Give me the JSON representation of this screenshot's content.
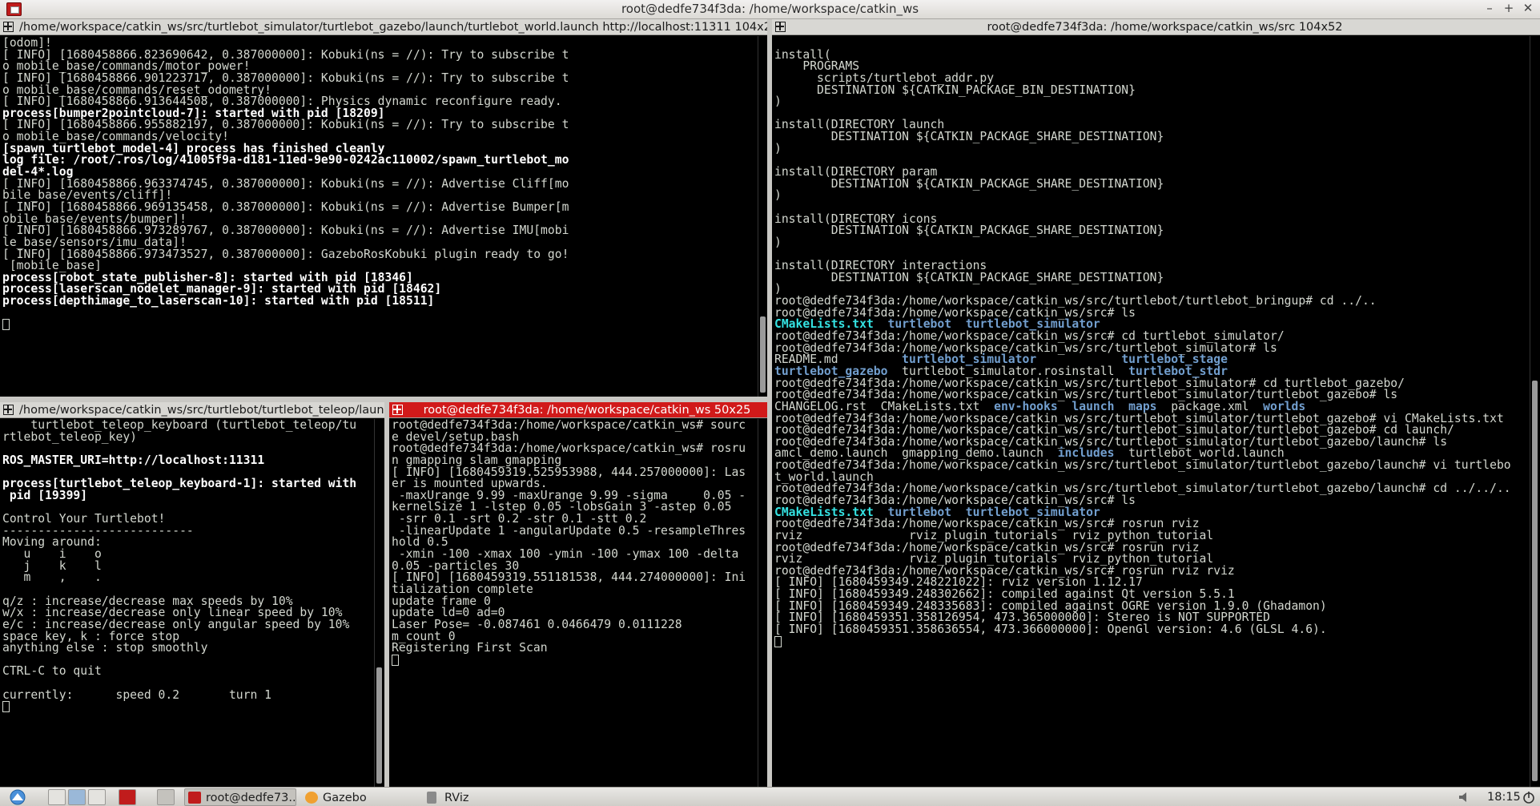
{
  "window": {
    "title": "root@dedfe734f3da: /home/workspace/catkin_ws",
    "minimize_glyph": "–",
    "maximize_glyph": "+",
    "close_glyph": "✕"
  },
  "panes": {
    "top_left": {
      "title": "/home/workspace/catkin_ws/src/turtlebot_simulator/turtlebot_gazebo/launch/turtlebot_world.launch http://localhost:11311 104x25",
      "lines": [
        {
          "t": "[odom]!",
          "s": ""
        },
        {
          "t": "[ INFO] [1680458866.823690642, 0.387000000]: Kobuki(ns = //): Try to subscribe t",
          "s": ""
        },
        {
          "t": "o mobile_base/commands/motor_power!",
          "s": ""
        },
        {
          "t": "[ INFO] [1680458866.901223717, 0.387000000]: Kobuki(ns = //): Try to subscribe t",
          "s": ""
        },
        {
          "t": "o mobile_base/commands/reset_odometry!",
          "s": ""
        },
        {
          "t": "[ INFO] [1680458866.913644508, 0.387000000]: Physics dynamic reconfigure ready.",
          "s": ""
        },
        {
          "t": "process[bumper2pointcloud-7]: started with pid [18209]",
          "s": "b"
        },
        {
          "t": "[ INFO] [1680458866.955882197, 0.387000000]: Kobuki(ns = //): Try to subscribe t",
          "s": ""
        },
        {
          "t": "o mobile_base/commands/velocity!",
          "s": ""
        },
        {
          "t": "[spawn_turtlebot_model-4] process has finished cleanly",
          "s": "b"
        },
        {
          "t": "log file: /root/.ros/log/41005f9a-d181-11ed-9e90-0242ac110002/spawn_turtlebot_mo",
          "s": "b"
        },
        {
          "t": "del-4*.log",
          "s": "b"
        },
        {
          "t": "[ INFO] [1680458866.963374745, 0.387000000]: Kobuki(ns = //): Advertise Cliff[mo",
          "s": ""
        },
        {
          "t": "bile_base/events/cliff]!",
          "s": ""
        },
        {
          "t": "[ INFO] [1680458866.969135458, 0.387000000]: Kobuki(ns = //): Advertise Bumper[m",
          "s": ""
        },
        {
          "t": "obile_base/events/bumper]!",
          "s": ""
        },
        {
          "t": "[ INFO] [1680458866.973289767, 0.387000000]: Kobuki(ns = //): Advertise IMU[mobi",
          "s": ""
        },
        {
          "t": "le_base/sensors/imu_data]!",
          "s": ""
        },
        {
          "t": "[ INFO] [1680458866.973473527, 0.387000000]: GazeboRosKobuki plugin ready to go!",
          "s": ""
        },
        {
          "t": " [mobile_base]",
          "s": ""
        },
        {
          "t": "process[robot_state_publisher-8]: started with pid [18346]",
          "s": "b"
        },
        {
          "t": "process[laserscan_nodelet_manager-9]: started with pid [18462]",
          "s": "b"
        },
        {
          "t": "process[depthimage_to_laserscan-10]: started with pid [18511]",
          "s": "b"
        },
        {
          "t": "",
          "s": ""
        },
        {
          "t": "",
          "s": "cursor"
        }
      ]
    },
    "right": {
      "title": "root@dedfe734f3da: /home/workspace/catkin_ws/src 104x52",
      "lines": [
        {
          "segs": [
            {
              "t": "",
              "s": ""
            }
          ]
        },
        {
          "segs": [
            {
              "t": "install(",
              "s": ""
            }
          ]
        },
        {
          "segs": [
            {
              "t": "    PROGRAMS",
              "s": ""
            }
          ]
        },
        {
          "segs": [
            {
              "t": "      scripts/turtlebot_addr.py",
              "s": ""
            }
          ]
        },
        {
          "segs": [
            {
              "t": "      DESTINATION ${CATKIN_PACKAGE_BIN_DESTINATION}",
              "s": ""
            }
          ]
        },
        {
          "segs": [
            {
              "t": ")",
              "s": ""
            }
          ]
        },
        {
          "segs": [
            {
              "t": "",
              "s": ""
            }
          ]
        },
        {
          "segs": [
            {
              "t": "install(DIRECTORY launch",
              "s": ""
            }
          ]
        },
        {
          "segs": [
            {
              "t": "        DESTINATION ${CATKIN_PACKAGE_SHARE_DESTINATION}",
              "s": ""
            }
          ]
        },
        {
          "segs": [
            {
              "t": ")",
              "s": ""
            }
          ]
        },
        {
          "segs": [
            {
              "t": "",
              "s": ""
            }
          ]
        },
        {
          "segs": [
            {
              "t": "install(DIRECTORY param",
              "s": ""
            }
          ]
        },
        {
          "segs": [
            {
              "t": "        DESTINATION ${CATKIN_PACKAGE_SHARE_DESTINATION}",
              "s": ""
            }
          ]
        },
        {
          "segs": [
            {
              "t": ")",
              "s": ""
            }
          ]
        },
        {
          "segs": [
            {
              "t": "",
              "s": ""
            }
          ]
        },
        {
          "segs": [
            {
              "t": "install(DIRECTORY icons",
              "s": ""
            }
          ]
        },
        {
          "segs": [
            {
              "t": "        DESTINATION ${CATKIN_PACKAGE_SHARE_DESTINATION}",
              "s": ""
            }
          ]
        },
        {
          "segs": [
            {
              "t": ")",
              "s": ""
            }
          ]
        },
        {
          "segs": [
            {
              "t": "",
              "s": ""
            }
          ]
        },
        {
          "segs": [
            {
              "t": "install(DIRECTORY interactions",
              "s": ""
            }
          ]
        },
        {
          "segs": [
            {
              "t": "        DESTINATION ${CATKIN_PACKAGE_SHARE_DESTINATION}",
              "s": ""
            }
          ]
        },
        {
          "segs": [
            {
              "t": ")",
              "s": ""
            }
          ]
        },
        {
          "segs": [
            {
              "t": "root@dedfe734f3da:/home/workspace/catkin_ws/src/turtlebot/turtlebot_bringup# cd ../..",
              "s": ""
            }
          ]
        },
        {
          "segs": [
            {
              "t": "root@dedfe734f3da:/home/workspace/catkin_ws/src# ls",
              "s": ""
            }
          ]
        },
        {
          "segs": [
            {
              "t": "CMakeLists.txt",
              "s": "cyan"
            },
            {
              "t": "  ",
              "s": ""
            },
            {
              "t": "turtlebot",
              "s": "dir"
            },
            {
              "t": "  ",
              "s": ""
            },
            {
              "t": "turtlebot_simulator",
              "s": "dir"
            }
          ]
        },
        {
          "segs": [
            {
              "t": "root@dedfe734f3da:/home/workspace/catkin_ws/src# cd turtlebot_simulator/",
              "s": ""
            }
          ]
        },
        {
          "segs": [
            {
              "t": "root@dedfe734f3da:/home/workspace/catkin_ws/src/turtlebot_simulator# ls",
              "s": ""
            }
          ]
        },
        {
          "segs": [
            {
              "t": "README.md         ",
              "s": ""
            },
            {
              "t": "turtlebot_simulator",
              "s": "dir"
            },
            {
              "t": "            ",
              "s": ""
            },
            {
              "t": "turtlebot_stage",
              "s": "dir"
            }
          ]
        },
        {
          "segs": [
            {
              "t": "turtlebot_gazebo",
              "s": "dir"
            },
            {
              "t": "  turtlebot_simulator.rosinstall  ",
              "s": ""
            },
            {
              "t": "turtlebot_stdr",
              "s": "dir"
            }
          ]
        },
        {
          "segs": [
            {
              "t": "root@dedfe734f3da:/home/workspace/catkin_ws/src/turtlebot_simulator# cd turtlebot_gazebo/",
              "s": ""
            }
          ]
        },
        {
          "segs": [
            {
              "t": "root@dedfe734f3da:/home/workspace/catkin_ws/src/turtlebot_simulator/turtlebot_gazebo# ls",
              "s": ""
            }
          ]
        },
        {
          "segs": [
            {
              "t": "CHANGELOG.rst  CMakeLists.txt  ",
              "s": ""
            },
            {
              "t": "env-hooks",
              "s": "dir"
            },
            {
              "t": "  ",
              "s": ""
            },
            {
              "t": "launch",
              "s": "dir"
            },
            {
              "t": "  ",
              "s": ""
            },
            {
              "t": "maps",
              "s": "dir"
            },
            {
              "t": "  package.xml  ",
              "s": ""
            },
            {
              "t": "worlds",
              "s": "dir"
            }
          ]
        },
        {
          "segs": [
            {
              "t": "root@dedfe734f3da:/home/workspace/catkin_ws/src/turtlebot_simulator/turtlebot_gazebo# vi CMakeLists.txt",
              "s": ""
            }
          ]
        },
        {
          "segs": [
            {
              "t": "root@dedfe734f3da:/home/workspace/catkin_ws/src/turtlebot_simulator/turtlebot_gazebo# cd launch/",
              "s": ""
            }
          ]
        },
        {
          "segs": [
            {
              "t": "root@dedfe734f3da:/home/workspace/catkin_ws/src/turtlebot_simulator/turtlebot_gazebo/launch# ls",
              "s": ""
            }
          ]
        },
        {
          "segs": [
            {
              "t": "amcl_demo.launch  gmapping_demo.launch  ",
              "s": ""
            },
            {
              "t": "includes",
              "s": "dir"
            },
            {
              "t": "  turtlebot_world.launch",
              "s": ""
            }
          ]
        },
        {
          "segs": [
            {
              "t": "root@dedfe734f3da:/home/workspace/catkin_ws/src/turtlebot_simulator/turtlebot_gazebo/launch# vi turtlebo",
              "s": ""
            }
          ]
        },
        {
          "segs": [
            {
              "t": "t_world.launch",
              "s": ""
            }
          ]
        },
        {
          "segs": [
            {
              "t": "root@dedfe734f3da:/home/workspace/catkin_ws/src/turtlebot_simulator/turtlebot_gazebo/launch# cd ../../..",
              "s": ""
            }
          ]
        },
        {
          "segs": [
            {
              "t": "root@dedfe734f3da:/home/workspace/catkin_ws/src# ls",
              "s": ""
            }
          ]
        },
        {
          "segs": [
            {
              "t": "CMakeLists.txt",
              "s": "cyan"
            },
            {
              "t": "  ",
              "s": ""
            },
            {
              "t": "turtlebot",
              "s": "dir"
            },
            {
              "t": "  ",
              "s": ""
            },
            {
              "t": "turtlebot_simulator",
              "s": "dir"
            }
          ]
        },
        {
          "segs": [
            {
              "t": "root@dedfe734f3da:/home/workspace/catkin_ws/src# rosrun rviz",
              "s": ""
            }
          ]
        },
        {
          "segs": [
            {
              "t": "rviz               rviz_plugin_tutorials  rviz_python_tutorial",
              "s": ""
            }
          ]
        },
        {
          "segs": [
            {
              "t": "root@dedfe734f3da:/home/workspace/catkin_ws/src# rosrun rviz",
              "s": ""
            }
          ]
        },
        {
          "segs": [
            {
              "t": "rviz               rviz_plugin_tutorials  rviz_python_tutorial",
              "s": ""
            }
          ]
        },
        {
          "segs": [
            {
              "t": "root@dedfe734f3da:/home/workspace/catkin_ws/src# rosrun rviz rviz",
              "s": ""
            }
          ]
        },
        {
          "segs": [
            {
              "t": "[ INFO] [1680459349.248221022]: rviz version 1.12.17",
              "s": ""
            }
          ]
        },
        {
          "segs": [
            {
              "t": "[ INFO] [1680459349.248302662]: compiled against Qt version 5.5.1",
              "s": ""
            }
          ]
        },
        {
          "segs": [
            {
              "t": "[ INFO] [1680459349.248335683]: compiled against OGRE version 1.9.0 (Ghadamon)",
              "s": ""
            }
          ]
        },
        {
          "segs": [
            {
              "t": "[ INFO] [1680459351.358126954, 473.365000000]: Stereo is NOT SUPPORTED",
              "s": ""
            }
          ]
        },
        {
          "segs": [
            {
              "t": "[ INFO] [1680459351.358636554, 473.366000000]: OpenGl version: 4.6 (GLSL 4.6).",
              "s": ""
            }
          ]
        },
        {
          "segs": [
            {
              "t": "",
              "s": "cursor"
            }
          ]
        }
      ]
    },
    "bottom_left": {
      "title": "/home/workspace/catkin_ws/src/turtlebot/turtlebot_teleop/laun",
      "lines": [
        {
          "t": "    turtlebot_teleop_keyboard (turtlebot_teleop/tu",
          "s": ""
        },
        {
          "t": "rtlebot_teleop_key)",
          "s": ""
        },
        {
          "t": "",
          "s": ""
        },
        {
          "t": "ROS_MASTER_URI=http://localhost:11311",
          "s": "b"
        },
        {
          "t": "",
          "s": ""
        },
        {
          "t": "process[turtlebot_teleop_keyboard-1]: started with",
          "s": "b"
        },
        {
          "t": " pid [19399]",
          "s": "b"
        },
        {
          "t": "",
          "s": ""
        },
        {
          "t": "Control Your Turtlebot!",
          "s": ""
        },
        {
          "t": "---------------------------",
          "s": ""
        },
        {
          "t": "Moving around:",
          "s": ""
        },
        {
          "t": "   u    i    o",
          "s": ""
        },
        {
          "t": "   j    k    l",
          "s": ""
        },
        {
          "t": "   m    ,    .",
          "s": ""
        },
        {
          "t": "",
          "s": ""
        },
        {
          "t": "q/z : increase/decrease max speeds by 10%",
          "s": ""
        },
        {
          "t": "w/x : increase/decrease only linear speed by 10%",
          "s": ""
        },
        {
          "t": "e/c : increase/decrease only angular speed by 10%",
          "s": ""
        },
        {
          "t": "space key, k : force stop",
          "s": ""
        },
        {
          "t": "anything else : stop smoothly",
          "s": ""
        },
        {
          "t": "",
          "s": ""
        },
        {
          "t": "CTRL-C to quit",
          "s": ""
        },
        {
          "t": "",
          "s": ""
        },
        {
          "t": "currently:      speed 0.2       turn 1",
          "s": ""
        },
        {
          "t": "",
          "s": "cursor"
        }
      ]
    },
    "bottom_middle": {
      "title": "root@dedfe734f3da: /home/workspace/catkin_ws 50x25",
      "lines": [
        {
          "t": "root@dedfe734f3da:/home/workspace/catkin_ws# sourc",
          "s": ""
        },
        {
          "t": "e devel/setup.bash",
          "s": ""
        },
        {
          "t": "root@dedfe734f3da:/home/workspace/catkin_ws# rosru",
          "s": ""
        },
        {
          "t": "n gmapping slam_gmapping",
          "s": ""
        },
        {
          "t": "[ INFO] [1680459319.525953988, 444.257000000]: Las",
          "s": ""
        },
        {
          "t": "er is mounted upwards.",
          "s": ""
        },
        {
          "t": " -maxUrange 9.99 -maxUrange 9.99 -sigma     0.05 -",
          "s": ""
        },
        {
          "t": "kernelSize 1 -lstep 0.05 -lobsGain 3 -astep 0.05",
          "s": ""
        },
        {
          "t": " -srr 0.1 -srt 0.2 -str 0.1 -stt 0.2",
          "s": ""
        },
        {
          "t": " -linearUpdate 1 -angularUpdate 0.5 -resampleThres",
          "s": ""
        },
        {
          "t": "hold 0.5",
          "s": ""
        },
        {
          "t": " -xmin -100 -xmax 100 -ymin -100 -ymax 100 -delta",
          "s": ""
        },
        {
          "t": "0.05 -particles 30",
          "s": ""
        },
        {
          "t": "[ INFO] [1680459319.551181538, 444.274000000]: Ini",
          "s": ""
        },
        {
          "t": "tialization complete",
          "s": ""
        },
        {
          "t": "update frame 0",
          "s": ""
        },
        {
          "t": "update ld=0 ad=0",
          "s": ""
        },
        {
          "t": "Laser Pose= -0.087461 0.0466479 0.0111228",
          "s": ""
        },
        {
          "t": "m_count 0",
          "s": ""
        },
        {
          "t": "Registering First Scan",
          "s": ""
        },
        {
          "t": "",
          "s": "cursor"
        }
      ]
    }
  },
  "taskbar": {
    "tasks": [
      {
        "label": "root@dedfe73...",
        "icon": "terminal-icon",
        "color": "#c01c1c"
      },
      {
        "label": "Gazebo",
        "icon": "gazebo-icon",
        "color": "#f0a030"
      },
      {
        "label": "RViz",
        "icon": "rviz-icon",
        "color": "#8a8a8a"
      }
    ],
    "clock": "18:15"
  },
  "colors": {
    "terminal_bg": "#000000",
    "terminal_fg": "#d3d7cf",
    "directory_blue": "#729fcf",
    "file_cyan": "#34e2e2",
    "active_pane_title": "#d11a1a"
  }
}
